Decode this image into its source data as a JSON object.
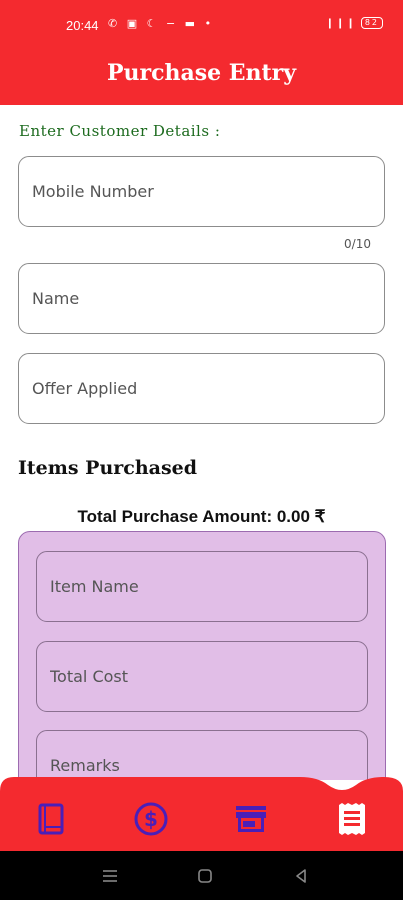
{
  "status_bar": {
    "time": "20:44",
    "left_icons": "✆ ▣ ☾ − ▬ •",
    "network": "❙❙❙",
    "battery": "82"
  },
  "app_bar": {
    "title": "Purchase Entry"
  },
  "customer": {
    "heading": "Enter Customer Details :",
    "mobile_placeholder": "Mobile Number",
    "mobile_counter": "0/10",
    "name_placeholder": "Name",
    "offer_placeholder": "Offer Applied"
  },
  "items": {
    "heading": "Items Purchased",
    "total_label": "Total Purchase Amount: 0.00 ₹",
    "item_name_placeholder": "Item Name",
    "total_cost_placeholder": "Total Cost",
    "remarks_placeholder": "Remarks"
  },
  "bottom_nav": {
    "background": "#f42a2f",
    "icon_color": "#4a1fb8",
    "active_icon_color": "#ffffff",
    "items": [
      {
        "icon": "book-icon"
      },
      {
        "icon": "dollar-icon"
      },
      {
        "icon": "store-icon"
      },
      {
        "icon": "receipt-icon",
        "active": true
      }
    ]
  }
}
